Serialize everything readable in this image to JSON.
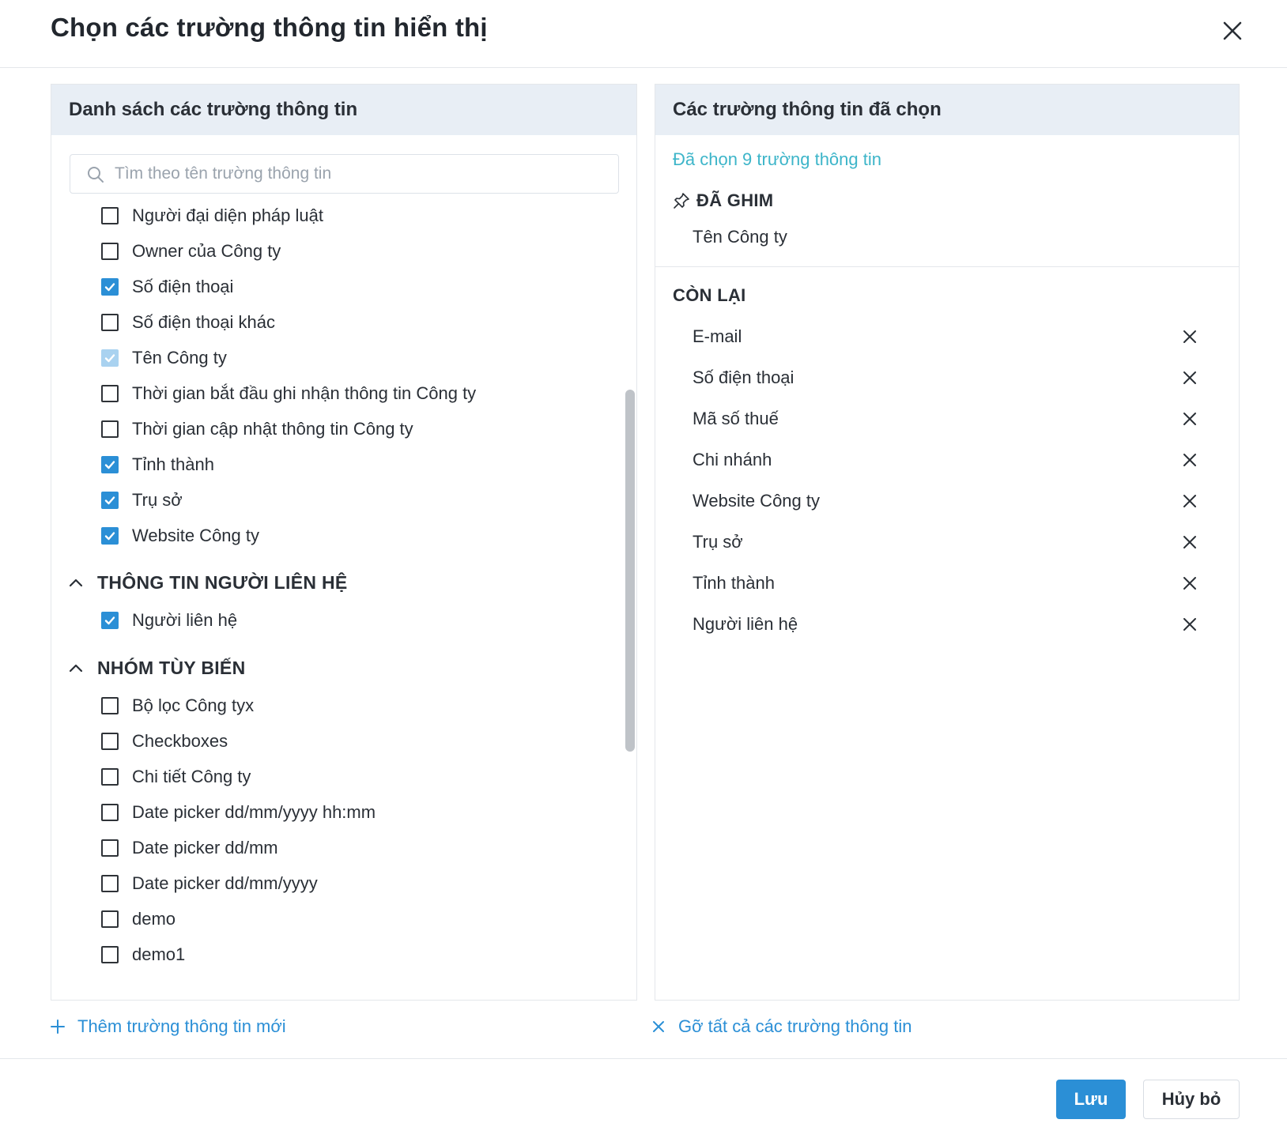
{
  "dialog": {
    "title": "Chọn các trường thông tin hiển thị",
    "close_icon": "close-icon"
  },
  "left_panel": {
    "header": "Danh sách các trường thông tin",
    "search": {
      "placeholder": "Tìm theo tên trường thông tin",
      "value": ""
    },
    "items_a": [
      {
        "label": "Người đại diện pháp luật",
        "state": "unchecked"
      },
      {
        "label": "Owner của Công ty",
        "state": "unchecked"
      },
      {
        "label": "Số điện thoại",
        "state": "checked"
      },
      {
        "label": "Số điện thoại khác",
        "state": "unchecked"
      },
      {
        "label": "Tên Công ty",
        "state": "checked-disabled"
      },
      {
        "label": "Thời gian bắt đầu ghi nhận thông tin Công ty",
        "state": "unchecked"
      },
      {
        "label": "Thời gian cập nhật thông tin Công ty",
        "state": "unchecked"
      },
      {
        "label": "Tỉnh thành",
        "state": "checked"
      },
      {
        "label": "Trụ sở",
        "state": "checked"
      },
      {
        "label": "Website Công ty",
        "state": "checked"
      }
    ],
    "groups": [
      {
        "label": "THÔNG TIN NGƯỜI LIÊN HỆ",
        "expanded": true,
        "icon": "chevron-up-icon"
      },
      {
        "label": "NHÓM TÙY BIẾN",
        "expanded": true,
        "icon": "chevron-up-icon"
      }
    ],
    "items_b": [
      {
        "label": "Người liên hệ",
        "state": "checked"
      }
    ],
    "items_c": [
      {
        "label": "Bộ lọc Công tyx",
        "state": "unchecked"
      },
      {
        "label": "Checkboxes",
        "state": "unchecked"
      },
      {
        "label": "Chi tiết Công ty",
        "state": "unchecked"
      },
      {
        "label": "Date picker dd/mm/yyyy hh:mm",
        "state": "unchecked"
      },
      {
        "label": "Date picker dd/mm",
        "state": "unchecked"
      },
      {
        "label": "Date picker dd/mm/yyyy",
        "state": "unchecked"
      },
      {
        "label": "demo",
        "state": "unchecked"
      },
      {
        "label": "demo1",
        "state": "unchecked"
      }
    ],
    "add_link": "Thêm trường thông tin mới"
  },
  "right_panel": {
    "header": "Các trường thông tin đã chọn",
    "selected_count": "Đã chọn 9 trường thông tin",
    "pinned_title": "ĐÃ GHIM",
    "pinned_items": [
      "Tên Công ty"
    ],
    "rest_title": "CÒN LẠI",
    "rest_items": [
      "E-mail",
      "Số điện thoại",
      "Mã số thuế",
      "Chi nhánh",
      "Website Công ty",
      "Trụ sở",
      "Tỉnh thành",
      "Người liên hệ"
    ],
    "remove_all_link": "Gỡ tất cả các trường thông tin"
  },
  "footer": {
    "save": "Lưu",
    "cancel": "Hủy bỏ"
  },
  "colors": {
    "accent": "#2b8fd6",
    "count_text": "#3db5c9",
    "panel_header_bg": "#e8eef5",
    "checked_disabled": "#a9d2f0"
  }
}
